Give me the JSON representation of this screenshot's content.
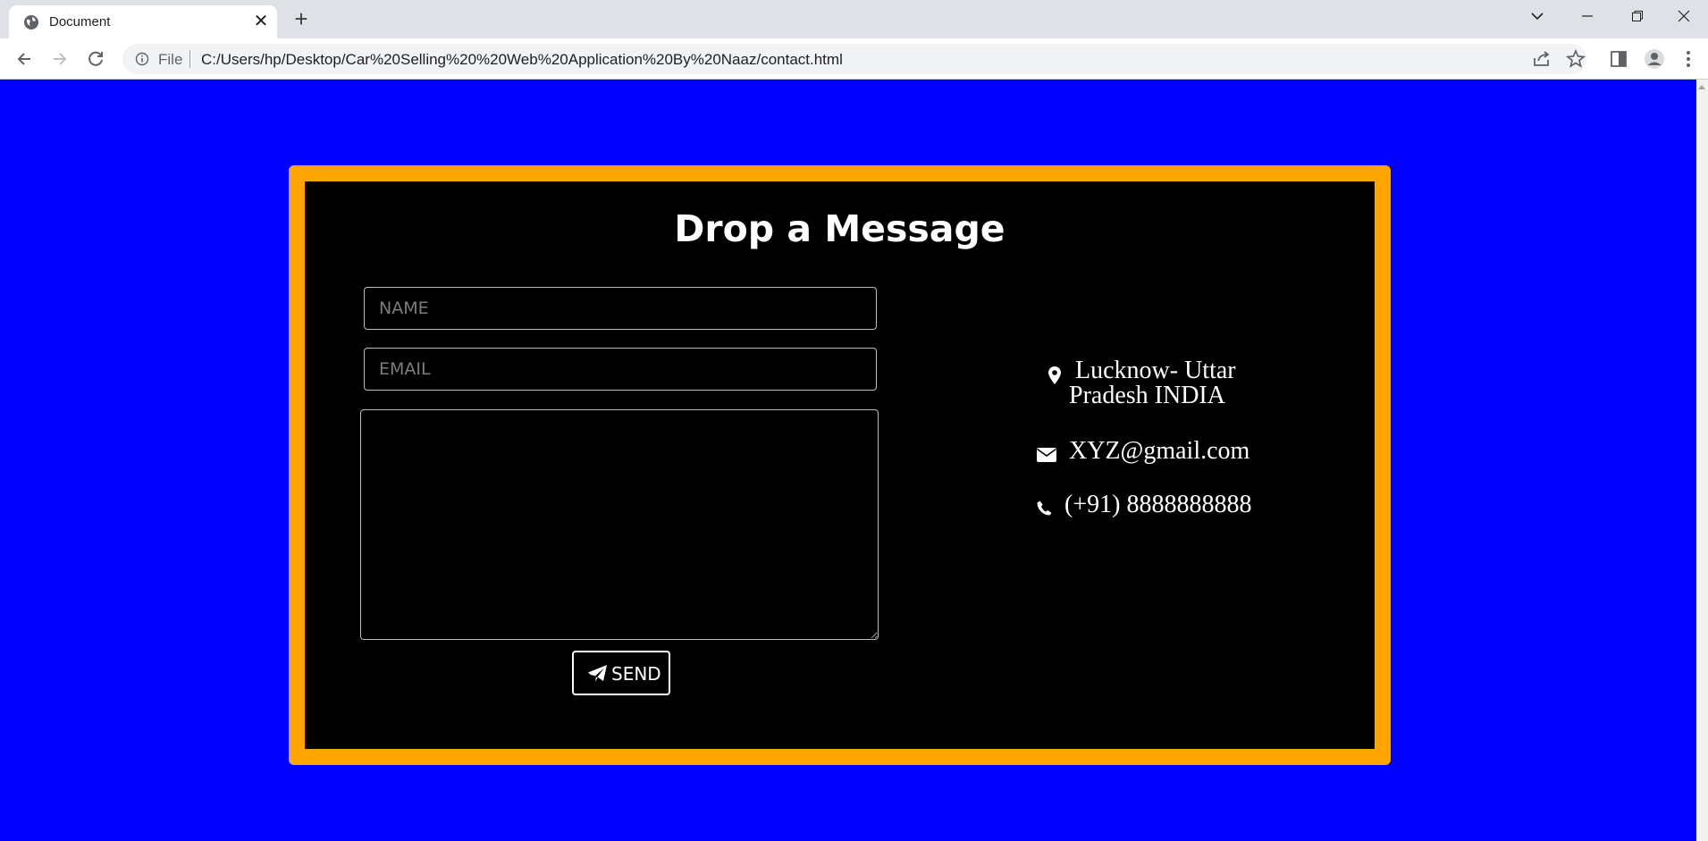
{
  "browser": {
    "tab_title": "Document",
    "omnibox_scheme": "File",
    "url": "C:/Users/hp/Desktop/Car%20Selling%20%20Web%20Application%20By%20Naaz/contact.html"
  },
  "colors": {
    "page_background": "#0000ff",
    "card_border": "#ffa500",
    "card_background": "#000000",
    "text": "#ffffff"
  },
  "contact_form": {
    "heading": "Drop a Message",
    "name_placeholder": "NAME",
    "email_placeholder": "EMAIL",
    "message_value": "",
    "send_label": "SEND",
    "send_icon": "paper-plane-icon"
  },
  "contact_info": {
    "location_icon": "map-marker-icon",
    "location_line1": "Lucknow- Uttar",
    "location_line2": "Pradesh INDIA",
    "email_icon": "envelope-icon",
    "email": "XYZ@gmail.com",
    "phone_icon": "phone-icon",
    "phone": "(+91) 8888888888"
  }
}
